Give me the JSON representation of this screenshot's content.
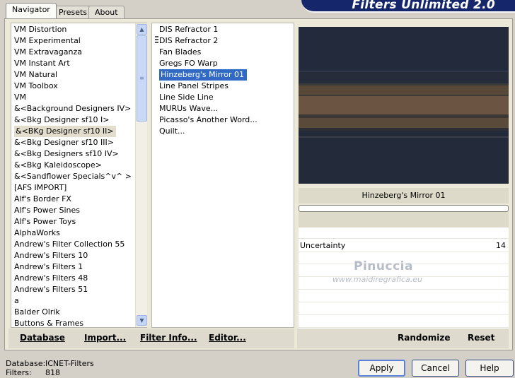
{
  "tabs": [
    {
      "label": "Navigator",
      "active": true
    },
    {
      "label": "Presets",
      "active": false
    },
    {
      "label": "About",
      "active": false
    }
  ],
  "banner_title": "Filters Unlimited 2.0",
  "categories": [
    "VM Distortion",
    "VM Experimental",
    "VM Extravaganza",
    "VM Instant Art",
    "VM Natural",
    "VM Toolbox",
    "VM",
    "&<Background Designers IV>",
    "&<Bkg Designer sf10 I>",
    "&<BKg Designer sf10 II>",
    "&<Bkg Designer sf10 III>",
    "&<Bkg Designers sf10 IV>",
    "&<Bkg Kaleidoscope>",
    "&<Sandflower Specials^v^ >",
    "[AFS IMPORT]",
    "Alf's Border FX",
    "Alf's Power Sines",
    "Alf's Power Toys",
    "AlphaWorks",
    "Andrew's Filter Collection 55",
    "Andrew's Filters 10",
    "Andrew's Filters 1",
    "Andrew's Filters 48",
    "Andrew's Filters 51",
    "a",
    "Balder Olrik",
    "Buttons & Frames"
  ],
  "selected_category_index": 9,
  "filters": [
    "DIS Refractor 1",
    "DIS Refractor 2",
    "Fan Blades",
    "Gregs FO Warp",
    "Hinzeberg's Mirror 01",
    "Line Panel Stripes",
    "Line Side Line",
    "MURUs Wave...",
    "Picasso's Another Word...",
    "Quilt..."
  ],
  "selected_filter_index": 4,
  "left_buttons": {
    "database": "Database",
    "import": "Import...",
    "filter_info": "Filter Info...",
    "editor": "Editor..."
  },
  "preview_filter_name": "Hinzeberg's Mirror 01",
  "parameters": [
    {
      "name": "Uncertainty",
      "value": "14"
    }
  ],
  "right_buttons": {
    "randomize": "Randomize",
    "reset": "Reset"
  },
  "watermark": {
    "line1": "Pinuccia",
    "line2": "www.maidiregrafica.eu"
  },
  "status": {
    "database_label": "Database:",
    "database_value": "ICNET-Filters",
    "filters_label": "Filters:",
    "filters_value": "818"
  },
  "dialog_buttons": {
    "apply": "Apply",
    "cancel": "Cancel",
    "help": "Help"
  },
  "colors": {
    "selection": "#316ac5",
    "banner": "#15266b",
    "preview_dark": "#232a3a",
    "preview_brown": "#6b5542"
  }
}
